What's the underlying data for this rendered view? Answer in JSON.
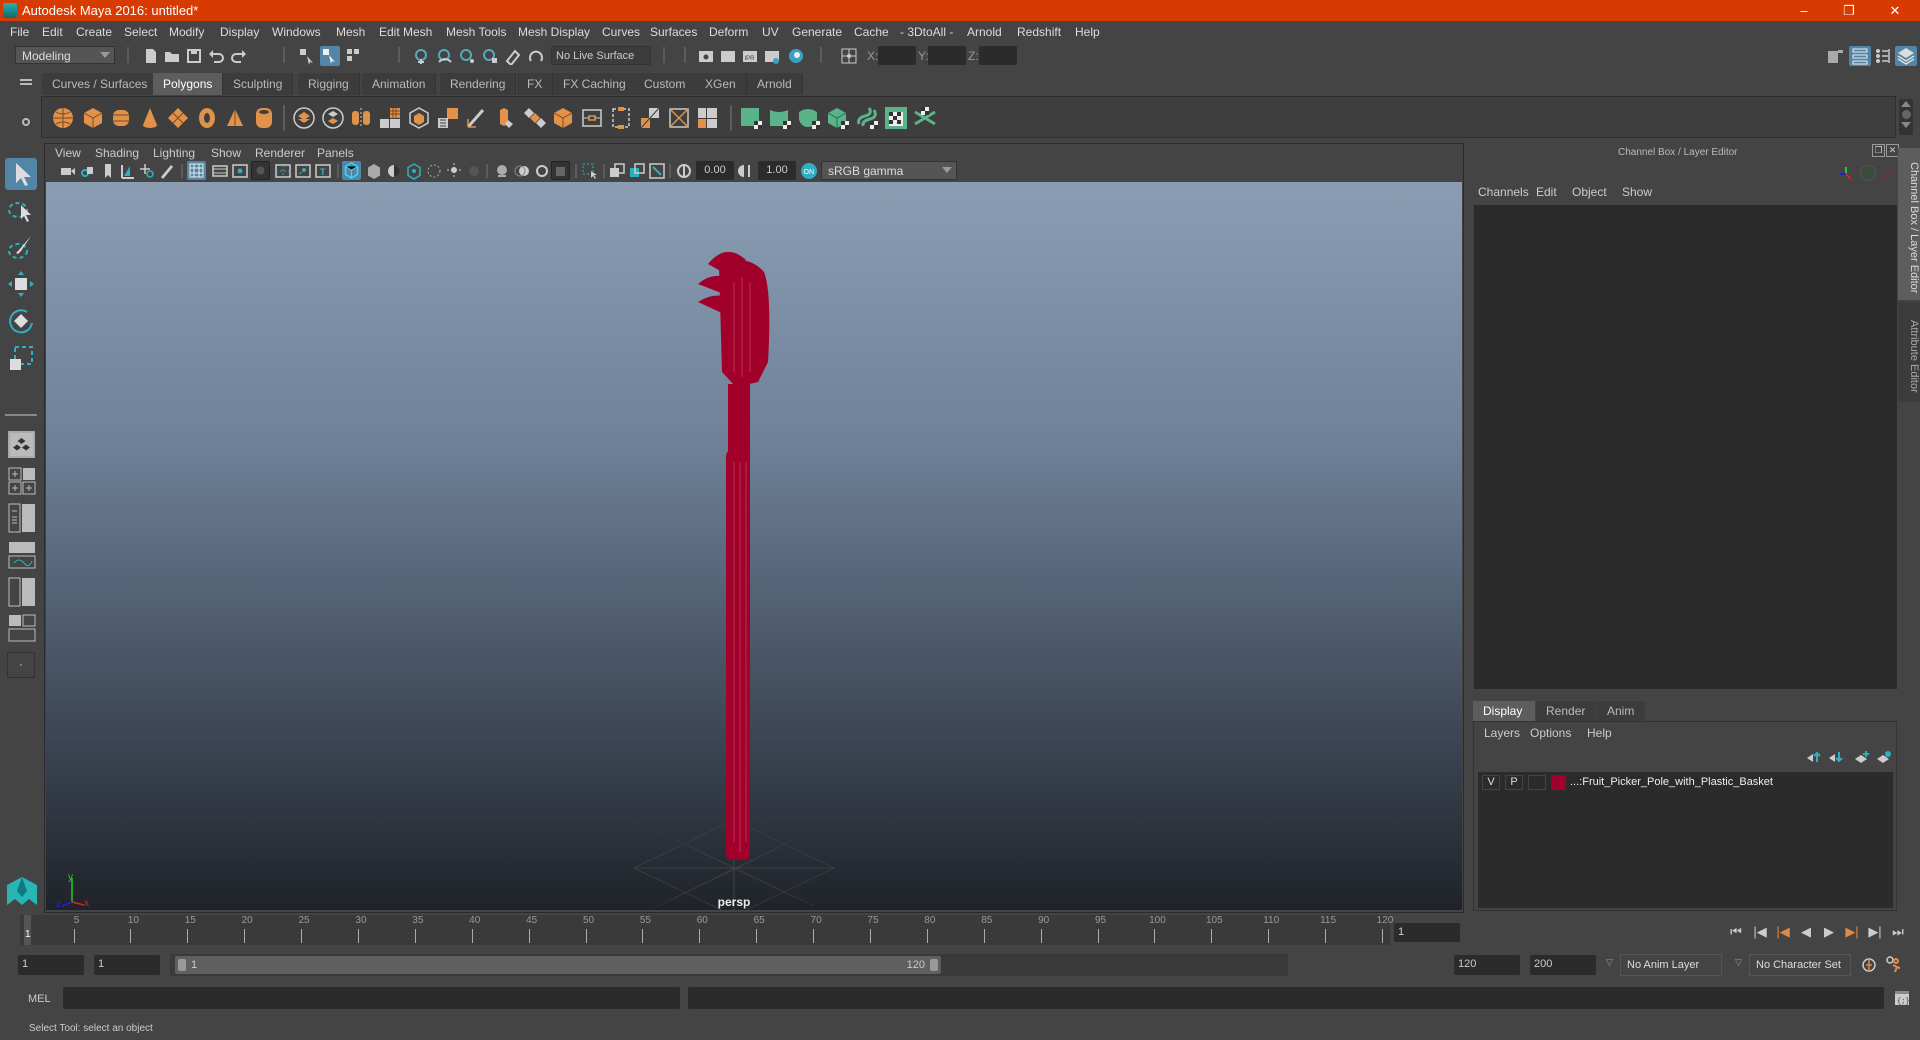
{
  "window": {
    "title": "Autodesk Maya 2016: untitled*",
    "controls": {
      "minimize": "–",
      "restore": "❐",
      "close": "✕"
    }
  },
  "menubar": [
    "File",
    "Edit",
    "Create",
    "Select",
    "Modify",
    "Display",
    "Windows",
    "Mesh",
    "Edit Mesh",
    "Mesh Tools",
    "Mesh Display",
    "Curves",
    "Surfaces",
    "Deform",
    "UV",
    "Generate",
    "Cache",
    "- 3DtoAll -",
    "Arnold",
    "Redshift",
    "Help"
  ],
  "statusline": {
    "menuset": "Modeling",
    "live_surface": "No Live Surface",
    "coord_labels": {
      "x": "X:",
      "y": "Y:",
      "z": "Z:"
    },
    "coord_values": {
      "x": "",
      "y": "",
      "z": ""
    }
  },
  "shelf": {
    "tabs": [
      "Curves / Surfaces",
      "Polygons",
      "Sculpting",
      "Rigging",
      "Animation",
      "Rendering",
      "FX",
      "FX Caching",
      "Custom",
      "XGen",
      "Arnold"
    ],
    "active_tab": "Polygons",
    "poly_icons": [
      "poly-sphere-icon",
      "poly-cube-icon",
      "poly-cylinder-icon",
      "poly-cone-icon",
      "poly-plane-icon",
      "poly-torus-icon",
      "poly-pyramid-icon",
      "poly-pipe-icon"
    ],
    "mesh_icons": [
      "combine-icon",
      "separate-icon",
      "mirror-icon",
      "smooth-icon",
      "extract-icon",
      "booleans-icon",
      "multi-cut-icon",
      "extrude-icon",
      "bridge-icon",
      "bevel-icon",
      "merge-icon",
      "append-icon",
      "fill-hole-icon",
      "target-weld-icon",
      "split-icon"
    ],
    "uv_icons": [
      "planar-uv-icon",
      "cylindrical-uv-icon",
      "spherical-uv-icon",
      "auto-uv-icon",
      "contour-uv-icon",
      "uv-editor-icon",
      "unfold-uv-icon"
    ]
  },
  "viewport": {
    "menus": [
      "View",
      "Shading",
      "Lighting",
      "Show",
      "Renderer",
      "Panels"
    ],
    "exposure": "0.00",
    "gamma": "1.00",
    "color_space": "sRGB gamma",
    "camera_label": "persp",
    "axis": {
      "x": "x",
      "y": "y",
      "z": "z"
    },
    "model_color": "#a0002a"
  },
  "channel_box": {
    "title": "Channel Box / Layer Editor",
    "menus": [
      "Channels",
      "Edit",
      "Object",
      "Show"
    ]
  },
  "layer_editor": {
    "tabs": [
      "Display",
      "Render",
      "Anim"
    ],
    "active_tab": "Display",
    "menus": [
      "Layers",
      "Options",
      "Help"
    ],
    "layers": [
      {
        "visible": "V",
        "playback": "P",
        "type": "",
        "color": "#a0002a",
        "name": "...:Fruit_Picker_Pole_with_Plastic_Basket"
      }
    ]
  },
  "side_tabs": [
    "Channel Box / Layer Editor",
    "Attribute Editor"
  ],
  "timeline": {
    "ticks": [
      "5",
      "10",
      "15",
      "20",
      "25",
      "30",
      "35",
      "40",
      "45",
      "50",
      "55",
      "60",
      "65",
      "70",
      "75",
      "80",
      "85",
      "90",
      "95",
      "100",
      "105",
      "110",
      "115",
      "120"
    ],
    "current_frame_marker": "1",
    "current_frame": "1",
    "range_start": 1,
    "range_end": 120
  },
  "range_slider": {
    "start_time": "1",
    "playback_start": "1",
    "slider_start": "1",
    "slider_end": "120",
    "playback_end": "120",
    "end_time": "200",
    "anim_layer": "No Anim Layer",
    "character_set": "No Character Set"
  },
  "command_line": {
    "label": "MEL",
    "input": "",
    "result": ""
  },
  "help_line": "Select Tool: select an object"
}
